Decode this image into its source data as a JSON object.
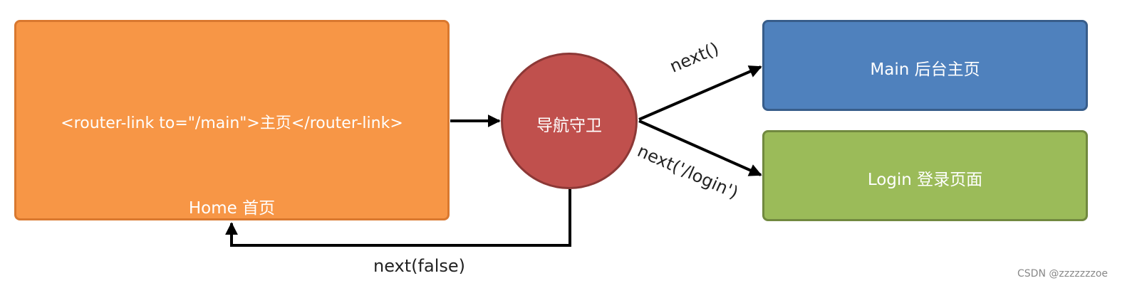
{
  "nodes": {
    "home": {
      "code": "<router-link to=\"/main\">主页</router-link>",
      "caption": "Home 首页",
      "color": "#f79646"
    },
    "guard": {
      "label": "导航守卫",
      "color": "#c0504d"
    },
    "main": {
      "label": "Main 后台主页",
      "color": "#4f81bd"
    },
    "login": {
      "label": "Login 登录页面",
      "color": "#9bbb59"
    }
  },
  "edges": {
    "next": "next()",
    "next_login": "next('/login')",
    "next_false": "next(false)"
  },
  "credit": "CSDN @zzzzzzzoe"
}
